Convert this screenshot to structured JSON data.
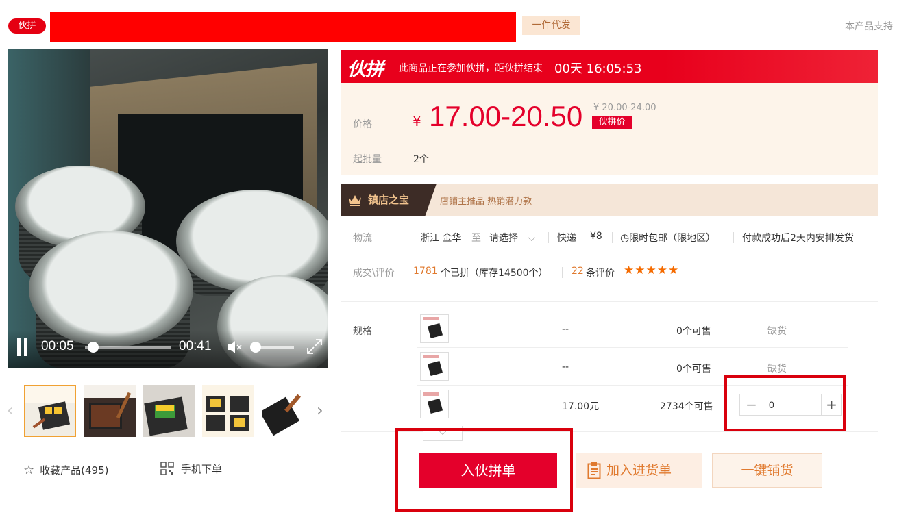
{
  "header": {
    "badge": "伙拼",
    "dropship_tag": "一件代发",
    "support_text": "本产品支持"
  },
  "video": {
    "current_time": "00:05",
    "duration": "00:41"
  },
  "thumbnails": [
    {
      "name": "thumb-1"
    },
    {
      "name": "thumb-2"
    },
    {
      "name": "thumb-3"
    },
    {
      "name": "thumb-4"
    },
    {
      "name": "thumb-5"
    }
  ],
  "actions_left": {
    "favorite_label": "收藏产品(495)",
    "mobile_label": "手机下单"
  },
  "promo": {
    "logo": "伙拼",
    "text": "此商品正在参加伙拼，距伙拼结束",
    "countdown": "00天 16:05:53"
  },
  "price": {
    "label": "价格",
    "currency": "¥",
    "range": "17.00-20.50",
    "original": "¥ 20.00-24.00",
    "tag": "伙拼价",
    "moq_label": "起批量",
    "moq_value": "2个"
  },
  "shop_bar": {
    "title": "镇店之宝",
    "recommend": "店铺主推品  热销潜力款"
  },
  "logistics": {
    "label": "物流",
    "origin": "浙江 金华",
    "to": "至",
    "destination": "请选择",
    "method": "快递",
    "fee": "¥8",
    "free_ship": "限时包邮（限地区）",
    "dispatch": "付款成功后2天内安排发货"
  },
  "deals": {
    "label": "成交\\评价",
    "count": "1781",
    "count_text": "个已拼（库存14500个）",
    "reviews_count": "22",
    "reviews_text": "条评价",
    "rating_stars": "★★★★★"
  },
  "spec": {
    "label": "规格",
    "rows": [
      {
        "price": "--",
        "available": "0个可售",
        "status": "缺货"
      },
      {
        "price": "--",
        "available": "0个可售",
        "status": "缺货"
      },
      {
        "price": "17.00元",
        "available": "2734个可售",
        "quantity": "0"
      }
    ]
  },
  "buttons": {
    "join": "入伙拼单",
    "add_cart": "加入进货单",
    "distribute": "一键铺货"
  },
  "colors": {
    "brand_red": "#e4002b",
    "highlight_red": "#d9000d",
    "orange": "#e07a2f"
  }
}
